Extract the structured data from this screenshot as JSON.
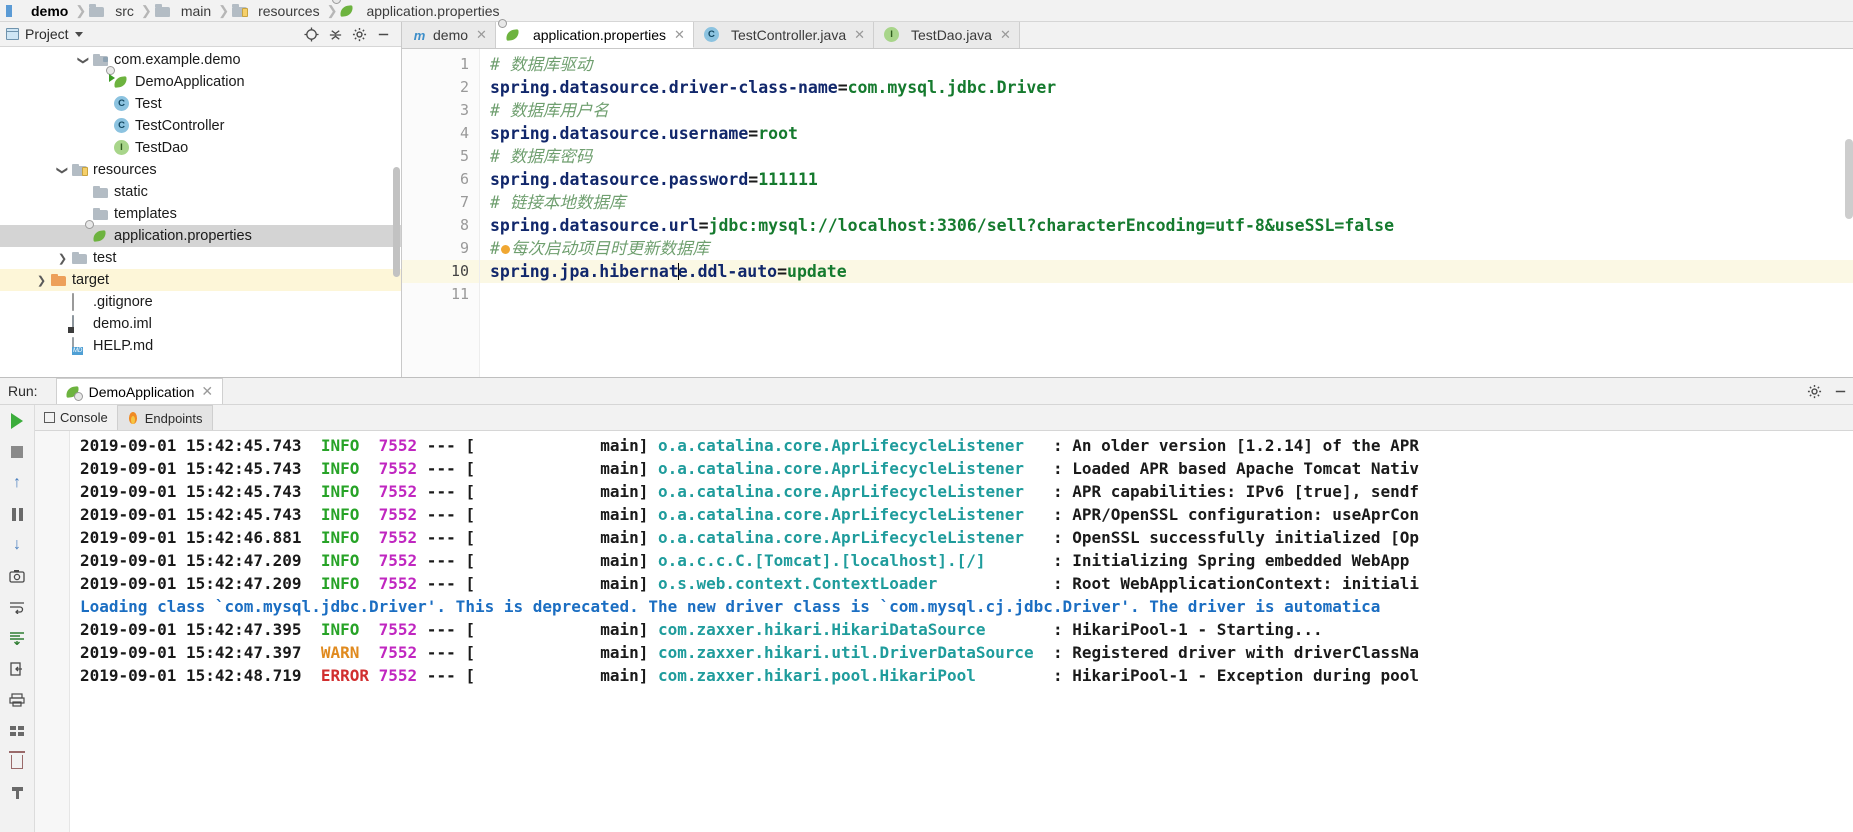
{
  "breadcrumb": [
    {
      "label": "demo",
      "icon": "module-icon"
    },
    {
      "label": "src",
      "icon": "folder-icon"
    },
    {
      "label": "main",
      "icon": "folder-icon"
    },
    {
      "label": "resources",
      "icon": "resources-folder-icon"
    },
    {
      "label": "application.properties",
      "icon": "spring-properties-icon"
    }
  ],
  "sidebar": {
    "title": "Project",
    "title_icon": "project-icon",
    "tools": [
      "locate-icon",
      "collapse-all-icon",
      "gear-icon",
      "minimize-icon"
    ],
    "tree": [
      {
        "label": "com.example.demo",
        "indent": 3,
        "arrow": "expanded",
        "icon": "package-folder-icon",
        "state": "normal"
      },
      {
        "label": "DemoApplication",
        "indent": 4,
        "arrow": "none",
        "icon": "spring-boot-run-icon",
        "state": "normal"
      },
      {
        "label": "Test",
        "indent": 4,
        "arrow": "none",
        "icon": "class-icon",
        "state": "normal"
      },
      {
        "label": "TestController",
        "indent": 4,
        "arrow": "none",
        "icon": "class-icon",
        "state": "normal"
      },
      {
        "label": "TestDao",
        "indent": 4,
        "arrow": "none",
        "icon": "interface-icon",
        "state": "normal"
      },
      {
        "label": "resources",
        "indent": 2,
        "arrow": "expanded",
        "icon": "resources-folder-icon",
        "state": "normal"
      },
      {
        "label": "static",
        "indent": 3,
        "arrow": "none",
        "icon": "folder-icon",
        "state": "normal"
      },
      {
        "label": "templates",
        "indent": 3,
        "arrow": "none",
        "icon": "folder-icon",
        "state": "normal"
      },
      {
        "label": "application.properties",
        "indent": 3,
        "arrow": "none",
        "icon": "spring-properties-icon",
        "state": "selected"
      },
      {
        "label": "test",
        "indent": 2,
        "arrow": "collapsed",
        "icon": "folder-icon",
        "state": "normal"
      },
      {
        "label": "target",
        "indent": 1,
        "arrow": "collapsed",
        "icon": "folder-orange-icon",
        "state": "highlight"
      },
      {
        "label": ".gitignore",
        "indent": 2,
        "arrow": "none",
        "icon": "file-icon",
        "state": "normal"
      },
      {
        "label": "demo.iml",
        "indent": 2,
        "arrow": "none",
        "icon": "iml-file-icon",
        "state": "normal"
      },
      {
        "label": "HELP.md",
        "indent": 2,
        "arrow": "none",
        "icon": "markdown-file-icon",
        "state": "normal"
      }
    ]
  },
  "editor": {
    "tabs": [
      {
        "label": "demo",
        "icon": "maven-icon",
        "active": false,
        "closable": true
      },
      {
        "label": "application.properties",
        "icon": "spring-properties-icon",
        "active": true,
        "closable": true
      },
      {
        "label": "TestController.java",
        "icon": "class-icon",
        "active": false,
        "closable": true
      },
      {
        "label": "TestDao.java",
        "icon": "interface-icon",
        "active": false,
        "closable": true
      }
    ],
    "caret_line": 10,
    "lines": [
      {
        "n": 1,
        "type": "comment",
        "text": "# 数据库驱动"
      },
      {
        "n": 2,
        "type": "prop",
        "key": "spring.datasource.driver-class-name",
        "value": "com.mysql.jdbc.Driver"
      },
      {
        "n": 3,
        "type": "comment",
        "text": "# 数据库用户名"
      },
      {
        "n": 4,
        "type": "prop",
        "key": "spring.datasource.username",
        "value": "root"
      },
      {
        "n": 5,
        "type": "comment",
        "text": "# 数据库密码"
      },
      {
        "n": 6,
        "type": "prop",
        "key": "spring.datasource.password",
        "value": "111111"
      },
      {
        "n": 7,
        "type": "comment",
        "text": "# 链接本地数据库"
      },
      {
        "n": 8,
        "type": "prop",
        "key": "spring.datasource.url",
        "value": "jdbc:mysql://localhost:3306/sell?characterEncoding=utf-8&useSSL=false"
      },
      {
        "n": 9,
        "type": "comment-warn",
        "prefix": "#",
        "text": "每次启动项目时更新数据库"
      },
      {
        "n": 10,
        "type": "prop-caret",
        "key_a": "spring.jpa.hibernat",
        "key_b": "e.ddl-auto",
        "value": "update"
      },
      {
        "n": 11,
        "type": "blank",
        "text": ""
      }
    ]
  },
  "run": {
    "label": "Run:",
    "config_name": "DemoApplication",
    "config_icon": "spring-boot-icon",
    "tools": [
      "gear-icon",
      "minimize-icon"
    ],
    "side_buttons": [
      "rerun-icon",
      "stop-icon",
      "scroll-up-icon",
      "pause-icon",
      "scroll-down-icon",
      "camera-icon",
      "wrap-icon",
      "scroll-end-icon",
      "export-icon",
      "print-icon",
      "layout-icon",
      "trash-icon",
      "pin-icon"
    ],
    "console_tabs": [
      {
        "label": "Console",
        "icon": "console-icon",
        "active": false
      },
      {
        "label": "Endpoints",
        "icon": "endpoints-icon",
        "active": true
      }
    ],
    "logs": [
      {
        "type": "std",
        "ts": "2019-09-01 15:42:45.743",
        "level": "INFO",
        "pid": "7552",
        "thread": "main",
        "logger": "o.a.catalina.core.AprLifecycleListener",
        "msg": "An older version [1.2.14] of the APR"
      },
      {
        "type": "std",
        "ts": "2019-09-01 15:42:45.743",
        "level": "INFO",
        "pid": "7552",
        "thread": "main",
        "logger": "o.a.catalina.core.AprLifecycleListener",
        "msg": "Loaded APR based Apache Tomcat Nativ"
      },
      {
        "type": "std",
        "ts": "2019-09-01 15:42:45.743",
        "level": "INFO",
        "pid": "7552",
        "thread": "main",
        "logger": "o.a.catalina.core.AprLifecycleListener",
        "msg": "APR capabilities: IPv6 [true], sendf"
      },
      {
        "type": "std",
        "ts": "2019-09-01 15:42:45.743",
        "level": "INFO",
        "pid": "7552",
        "thread": "main",
        "logger": "o.a.catalina.core.AprLifecycleListener",
        "msg": "APR/OpenSSL configuration: useAprCon"
      },
      {
        "type": "std",
        "ts": "2019-09-01 15:42:46.881",
        "level": "INFO",
        "pid": "7552",
        "thread": "main",
        "logger": "o.a.catalina.core.AprLifecycleListener",
        "msg": "OpenSSL successfully initialized [Op"
      },
      {
        "type": "std",
        "ts": "2019-09-01 15:42:47.209",
        "level": "INFO",
        "pid": "7552",
        "thread": "main",
        "logger": "o.a.c.c.C.[Tomcat].[localhost].[/]",
        "msg": "Initializing Spring embedded WebApp"
      },
      {
        "type": "std",
        "ts": "2019-09-01 15:42:47.209",
        "level": "INFO",
        "pid": "7552",
        "thread": "main",
        "logger": "o.s.web.context.ContextLoader",
        "msg": "Root WebApplicationContext: initiali"
      },
      {
        "type": "plain",
        "text": "Loading class `com.mysql.jdbc.Driver'. This is deprecated. The new driver class is `com.mysql.cj.jdbc.Driver'. The driver is automatica"
      },
      {
        "type": "std",
        "ts": "2019-09-01 15:42:47.395",
        "level": "INFO",
        "pid": "7552",
        "thread": "main",
        "logger": "com.zaxxer.hikari.HikariDataSource",
        "msg": "HikariPool-1 - Starting..."
      },
      {
        "type": "std",
        "ts": "2019-09-01 15:42:47.397",
        "level": "WARN",
        "pid": "7552",
        "thread": "main",
        "logger": "com.zaxxer.hikari.util.DriverDataSource",
        "msg": "Registered driver with driverClassNa"
      },
      {
        "type": "std",
        "ts": "2019-09-01 15:42:48.719",
        "level": "ERROR",
        "pid": "7552",
        "thread": "main",
        "logger": "com.zaxxer.hikari.pool.HikariPool",
        "msg": "HikariPool-1 - Exception during pool"
      }
    ]
  },
  "colors": {
    "spring_green": "#6db33f",
    "info": "#27a327",
    "warn": "#e08a1e",
    "error": "#d12f2f",
    "pid": "#c026c0",
    "logger": "#1f9c9c",
    "prop_key": "#11276b",
    "prop_value": "#157a2e",
    "comment": "#6f9f6f",
    "selection": "#d4d4d4",
    "highlight": "#fdf6d8",
    "caret_line": "#fbf8e4"
  }
}
